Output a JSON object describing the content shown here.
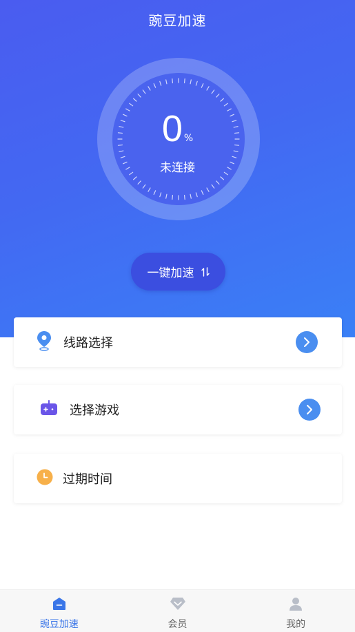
{
  "header": {
    "title": "豌豆加速"
  },
  "gauge": {
    "value": "0",
    "unit": "%",
    "status": "未连接"
  },
  "accelerate_button": {
    "label": "一键加速",
    "icon": "swap-arrows-icon"
  },
  "cards": [
    {
      "label": "线路选择",
      "icon": "location-pin-icon",
      "icon_color": "#4a8ef0",
      "has_arrow": true
    },
    {
      "label": "选择游戏",
      "icon": "gamepad-icon",
      "icon_color": "#6a55e8",
      "has_arrow": true
    },
    {
      "label": "过期时间",
      "icon": "clock-icon",
      "icon_color": "#f7b04a",
      "has_arrow": false
    }
  ],
  "tabbar": {
    "items": [
      {
        "label": "豌豆加速",
        "icon": "home-icon",
        "active": true
      },
      {
        "label": "会员",
        "icon": "diamond-icon",
        "active": false
      },
      {
        "label": "我的",
        "icon": "user-icon",
        "active": false
      }
    ]
  },
  "colors": {
    "accent": "#3a76e8",
    "hero_start": "#4a5cf0",
    "hero_end": "#3a80f6",
    "arrow_button": "#4a8ef0"
  }
}
